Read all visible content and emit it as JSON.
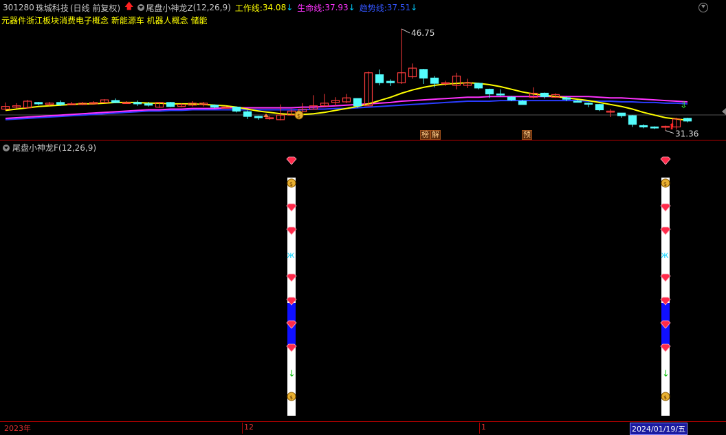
{
  "header": {
    "stock_code": "301280",
    "stock_name": "珠城科技",
    "period_label": "(日线 前复权)",
    "indicator_name": "尾盘小神龙Z",
    "indicator_params": "(12,26,9)",
    "work_line_label": "工作线:",
    "work_line_value": "34.08",
    "life_line_label": "生命线:",
    "life_line_value": "37.93",
    "trend_line_label": "趋势线:",
    "trend_line_value": "37.51",
    "arrow_down": "↓",
    "colors": {
      "work": "#ffff00",
      "life": "#ff33ff",
      "trend": "#3355ff"
    }
  },
  "concepts": "元器件浙江板块消费电子概念 新能源车 机器人概念 储能",
  "sub_panel": {
    "indicator_name": "尾盘小神龙F",
    "indicator_params": "(12,26,9)"
  },
  "tags": [
    "榜",
    "解",
    "预"
  ],
  "x_axis": {
    "labels": [
      "2023年",
      "12",
      "1"
    ],
    "current_date": "2024/01/19/五"
  },
  "chart_data": {
    "type": "candlestick",
    "high_label": "46.75",
    "low_label": "31.36",
    "candles": [
      {
        "o": 34.6,
        "c": 35.0,
        "h": 35.6,
        "l": 34.4
      },
      {
        "o": 34.9,
        "c": 35.1,
        "h": 35.5,
        "l": 34.7
      },
      {
        "o": 34.8,
        "c": 35.8,
        "h": 36.0,
        "l": 34.7
      },
      {
        "o": 35.6,
        "c": 35.4,
        "h": 35.7,
        "l": 35.2
      },
      {
        "o": 35.3,
        "c": 35.5,
        "h": 35.7,
        "l": 35.1
      },
      {
        "o": 35.6,
        "c": 35.3,
        "h": 35.9,
        "l": 35.1
      },
      {
        "o": 35.4,
        "c": 35.4,
        "h": 35.7,
        "l": 35.2
      },
      {
        "o": 35.3,
        "c": 35.5,
        "h": 35.7,
        "l": 35.2
      },
      {
        "o": 35.4,
        "c": 35.6,
        "h": 35.8,
        "l": 35.3
      },
      {
        "o": 35.6,
        "c": 36.0,
        "h": 36.1,
        "l": 35.5
      },
      {
        "o": 35.9,
        "c": 35.6,
        "h": 36.2,
        "l": 35.5
      },
      {
        "o": 35.6,
        "c": 35.6,
        "h": 35.8,
        "l": 35.5
      },
      {
        "o": 35.6,
        "c": 35.4,
        "h": 35.9,
        "l": 35.1
      },
      {
        "o": 35.4,
        "c": 35.2,
        "h": 35.7,
        "l": 35.0
      },
      {
        "o": 34.9,
        "c": 35.6,
        "h": 35.7,
        "l": 34.8
      },
      {
        "o": 35.6,
        "c": 35.0,
        "h": 35.7,
        "l": 34.9
      },
      {
        "o": 35.0,
        "c": 35.3,
        "h": 35.5,
        "l": 34.9
      },
      {
        "o": 35.2,
        "c": 35.5,
        "h": 35.8,
        "l": 35.0
      },
      {
        "o": 35.3,
        "c": 35.5,
        "h": 35.7,
        "l": 35.0
      },
      {
        "o": 35.2,
        "c": 34.9,
        "h": 35.3,
        "l": 34.7
      },
      {
        "o": 34.9,
        "c": 34.9,
        "h": 35.1,
        "l": 34.7
      },
      {
        "o": 34.9,
        "c": 34.3,
        "h": 35.0,
        "l": 34.1
      },
      {
        "o": 34.2,
        "c": 33.5,
        "h": 34.4,
        "l": 33.1
      },
      {
        "o": 33.5,
        "c": 33.3,
        "h": 33.6,
        "l": 33.0
      },
      {
        "o": 33.3,
        "c": 33.3,
        "h": 33.6,
        "l": 33.0
      },
      {
        "o": 33.0,
        "c": 33.7,
        "h": 35.3,
        "l": 32.9
      },
      {
        "o": 33.7,
        "c": 34.3,
        "h": 34.6,
        "l": 33.7
      },
      {
        "o": 34.2,
        "c": 34.6,
        "h": 35.5,
        "l": 34.0
      },
      {
        "o": 34.6,
        "c": 35.1,
        "h": 36.7,
        "l": 34.5
      },
      {
        "o": 35.1,
        "c": 35.5,
        "h": 36.9,
        "l": 35.0
      },
      {
        "o": 35.6,
        "c": 35.9,
        "h": 36.4,
        "l": 35.0
      },
      {
        "o": 35.7,
        "c": 36.3,
        "h": 36.9,
        "l": 35.5
      },
      {
        "o": 36.2,
        "c": 35.1,
        "h": 36.2,
        "l": 34.8
      },
      {
        "o": 35.1,
        "c": 40.1,
        "h": 40.3,
        "l": 35.1
      },
      {
        "o": 39.8,
        "c": 38.6,
        "h": 40.6,
        "l": 38.2
      },
      {
        "o": 38.8,
        "c": 38.6,
        "h": 39.1,
        "l": 38.1
      },
      {
        "o": 38.6,
        "c": 40.1,
        "h": 46.75,
        "l": 38.4
      },
      {
        "o": 39.5,
        "c": 40.8,
        "h": 41.5,
        "l": 39.2
      },
      {
        "o": 40.6,
        "c": 39.3,
        "h": 40.7,
        "l": 38.4
      },
      {
        "o": 39.3,
        "c": 38.5,
        "h": 39.6,
        "l": 37.9
      },
      {
        "o": 38.6,
        "c": 38.6,
        "h": 38.9,
        "l": 38.1
      },
      {
        "o": 38.2,
        "c": 39.6,
        "h": 40.1,
        "l": 37.6
      },
      {
        "o": 38.2,
        "c": 38.6,
        "h": 39.2,
        "l": 37.8
      },
      {
        "o": 38.5,
        "c": 37.8,
        "h": 38.6,
        "l": 37.6
      },
      {
        "o": 37.6,
        "c": 36.9,
        "h": 37.7,
        "l": 36.3
      },
      {
        "o": 36.9,
        "c": 36.8,
        "h": 37.6,
        "l": 36.6
      },
      {
        "o": 36.4,
        "c": 36.0,
        "h": 36.6,
        "l": 35.8
      },
      {
        "o": 35.8,
        "c": 35.3,
        "h": 36.0,
        "l": 35.3
      },
      {
        "o": 36.4,
        "c": 37.0,
        "h": 37.9,
        "l": 36.2
      },
      {
        "o": 37.0,
        "c": 36.5,
        "h": 37.1,
        "l": 36.2
      },
      {
        "o": 36.4,
        "c": 36.8,
        "h": 37.0,
        "l": 36.3
      },
      {
        "o": 36.3,
        "c": 36.1,
        "h": 36.5,
        "l": 35.8
      },
      {
        "o": 35.8,
        "c": 35.7,
        "h": 36.0,
        "l": 35.6
      },
      {
        "o": 35.5,
        "c": 35.4,
        "h": 35.6,
        "l": 34.9
      },
      {
        "o": 35.3,
        "c": 34.5,
        "h": 35.4,
        "l": 34.3
      },
      {
        "o": 34.3,
        "c": 34.3,
        "h": 34.6,
        "l": 33.4
      },
      {
        "o": 34.0,
        "c": 33.6,
        "h": 34.0,
        "l": 33.3
      },
      {
        "o": 33.6,
        "c": 32.3,
        "h": 33.7,
        "l": 31.9
      },
      {
        "o": 32.1,
        "c": 31.9,
        "h": 32.3,
        "l": 31.7
      },
      {
        "o": 31.9,
        "c": 31.8,
        "h": 32.0,
        "l": 31.6
      },
      {
        "o": 32.0,
        "c": 32.0,
        "h": 32.1,
        "l": 31.36
      },
      {
        "o": 31.9,
        "c": 33.1,
        "h": 33.3,
        "l": 31.5
      },
      {
        "o": 33.2,
        "c": 32.8,
        "h": 33.3,
        "l": 32.6
      }
    ],
    "ma_work": [
      34.4,
      34.6,
      34.8,
      35.0,
      35.1,
      35.2,
      35.3,
      35.4,
      35.4,
      35.5,
      35.6,
      35.6,
      35.6,
      35.5,
      35.5,
      35.4,
      35.4,
      35.4,
      35.3,
      35.2,
      35.1,
      34.9,
      34.6,
      34.3,
      34.1,
      33.9,
      33.8,
      33.8,
      33.9,
      34.1,
      34.4,
      34.7,
      35.0,
      35.4,
      35.9,
      36.4,
      37.0,
      37.5,
      37.9,
      38.2,
      38.4,
      38.5,
      38.6,
      38.5,
      38.3,
      38.0,
      37.6,
      37.2,
      36.9,
      36.7,
      36.5,
      36.3,
      36.1,
      35.9,
      35.6,
      35.3,
      35.0,
      34.6,
      34.1,
      33.7,
      33.3,
      33.1,
      32.9
    ],
    "ma_life": [
      33.2,
      33.3,
      33.4,
      33.5,
      33.6,
      33.7,
      33.8,
      33.9,
      34.0,
      34.1,
      34.2,
      34.3,
      34.4,
      34.5,
      34.5,
      34.6,
      34.6,
      34.7,
      34.7,
      34.7,
      34.8,
      34.8,
      34.8,
      34.8,
      34.8,
      34.8,
      34.8,
      34.9,
      34.9,
      35.0,
      35.1,
      35.2,
      35.3,
      35.4,
      35.5,
      35.6,
      35.8,
      35.9,
      36.0,
      36.1,
      36.2,
      36.3,
      36.4,
      36.4,
      36.5,
      36.5,
      36.5,
      36.5,
      36.5,
      36.5,
      36.5,
      36.5,
      36.5,
      36.5,
      36.4,
      36.3,
      36.3,
      36.2,
      36.1,
      36.0,
      35.9,
      35.8,
      35.7
    ],
    "ma_trend": [
      33.0,
      33.1,
      33.2,
      33.3,
      33.4,
      33.5,
      33.6,
      33.7,
      33.8,
      33.9,
      34.0,
      34.1,
      34.2,
      34.3,
      34.3,
      34.4,
      34.4,
      34.5,
      34.5,
      34.5,
      34.5,
      34.5,
      34.5,
      34.5,
      34.5,
      34.5,
      34.5,
      34.5,
      34.6,
      34.6,
      34.7,
      34.7,
      34.8,
      34.9,
      35.0,
      35.1,
      35.2,
      35.3,
      35.4,
      35.5,
      35.6,
      35.7,
      35.8,
      35.8,
      35.8,
      35.9,
      35.9,
      35.9,
      35.9,
      35.9,
      35.9,
      35.9,
      35.9,
      35.8,
      35.8,
      35.8,
      35.7,
      35.7,
      35.6,
      35.6,
      35.5,
      35.5,
      35.4
    ],
    "ylim": [
      30.8,
      48.2
    ],
    "signal_bar_indices": [
      26,
      60
    ]
  }
}
